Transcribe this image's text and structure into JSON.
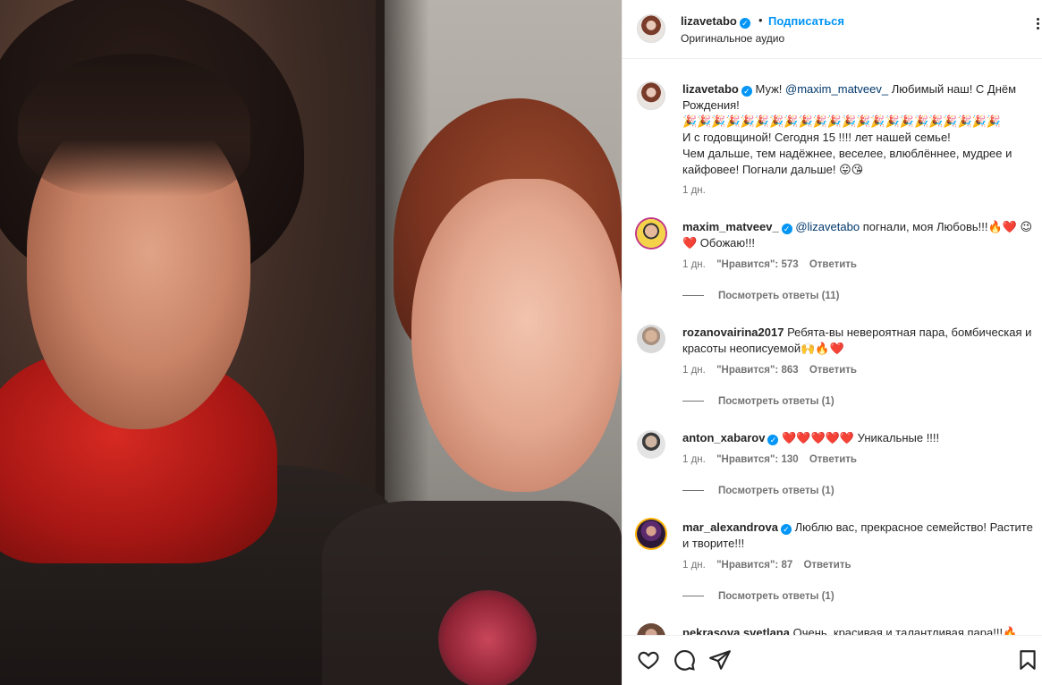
{
  "post": {
    "author": "lizavetabo",
    "follow_label": "Подписаться",
    "dot": "•",
    "audio": "Оригинальное аудио"
  },
  "caption": {
    "author": "lizavetabo",
    "line1_a": "Муж! ",
    "mention": "@maxim_matveev_",
    "line1_b": " Любимый наш! С Днём Рождения!",
    "emoji_row": "🎉🎉🎉🎉🎉🎉🎉🎉🎉🎉🎉🎉🎉🎉🎉🎉🎉🎉🎉🎉🎉🎉",
    "line3": "И с годовщиной! Сегодня 15 !!!! лет нашей семье!",
    "line4": "Чем дальше, тем надёжнее, веселее, влюблённее, мудрее и кайфовее! Погнали дальше! 😛😘",
    "time": "1 дн."
  },
  "comments": [
    {
      "user": "maxim_matveev_",
      "verified": true,
      "mention": "@lizavetabo",
      "text": " погнали, моя Любовь!!!🔥❤️ 😉❤️ Обожаю!!!",
      "time": "1 дн.",
      "likes": "\"Нравится\": 573",
      "reply": "Ответить",
      "view_replies": "Посмотреть ответы (11)"
    },
    {
      "user": "rozanovairina2017",
      "verified": false,
      "text": "Ребята-вы невероятная пара, бомбическая и красоты неописуемой🙌🔥❤️",
      "time": "1 дн.",
      "likes": "\"Нравится\": 863",
      "reply": "Ответить",
      "view_replies": "Посмотреть ответы (1)"
    },
    {
      "user": "anton_xabarov",
      "verified": true,
      "text": "❤️❤️❤️❤️❤️ Уникальные !!!!",
      "time": "1 дн.",
      "likes": "\"Нравится\": 130",
      "reply": "Ответить",
      "view_replies": "Посмотреть ответы (1)"
    },
    {
      "user": "mar_alexandrova",
      "verified": true,
      "text": "Люблю вас, прекрасное семейство! Растите и творите!!!",
      "time": "1 дн.",
      "likes": "\"Нравится\": 87",
      "reply": "Ответить",
      "view_replies": "Посмотреть ответы (1)"
    },
    {
      "user": "pekrasova.svetlana",
      "verified": false,
      "text": "Очень, красивая и талантливая пара!!!🔥"
    }
  ],
  "icons": {
    "like": "heart-icon",
    "comment": "comment-icon",
    "share": "paper-plane-icon",
    "save": "bookmark-icon"
  },
  "colors": {
    "link": "#0095f6",
    "mention": "#00376b",
    "heart": "#ed4956",
    "secondary": "#737373"
  }
}
